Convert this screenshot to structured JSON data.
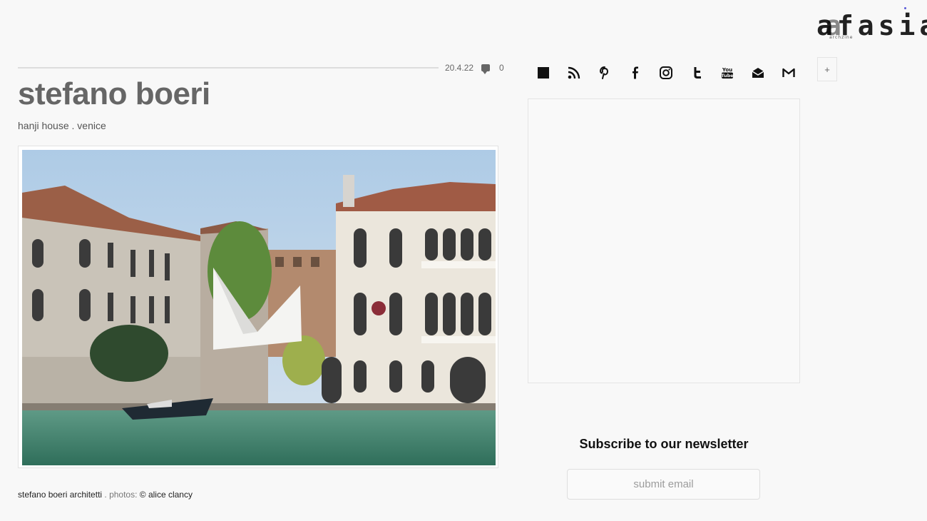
{
  "logo": {
    "text": "afasia",
    "ghost": "a",
    "sub": "archzine"
  },
  "post": {
    "date": "20.4.22",
    "comment_count": "0",
    "title": "stefano boeri",
    "subtitle": "hanji house . venice",
    "caption_credit": "stefano boeri architetti",
    "caption_sep": " . photos: ",
    "caption_photographer": "© alice clancy"
  },
  "social": {
    "icons": [
      "square-icon",
      "rss-icon",
      "pinterest-icon",
      "facebook-icon",
      "instagram-icon",
      "tumblr-icon",
      "youtube-icon",
      "mail-open-icon",
      "gmail-icon"
    ],
    "more_label": "+"
  },
  "newsletter": {
    "title": "Subscribe to our newsletter",
    "placeholder": "submit email"
  }
}
